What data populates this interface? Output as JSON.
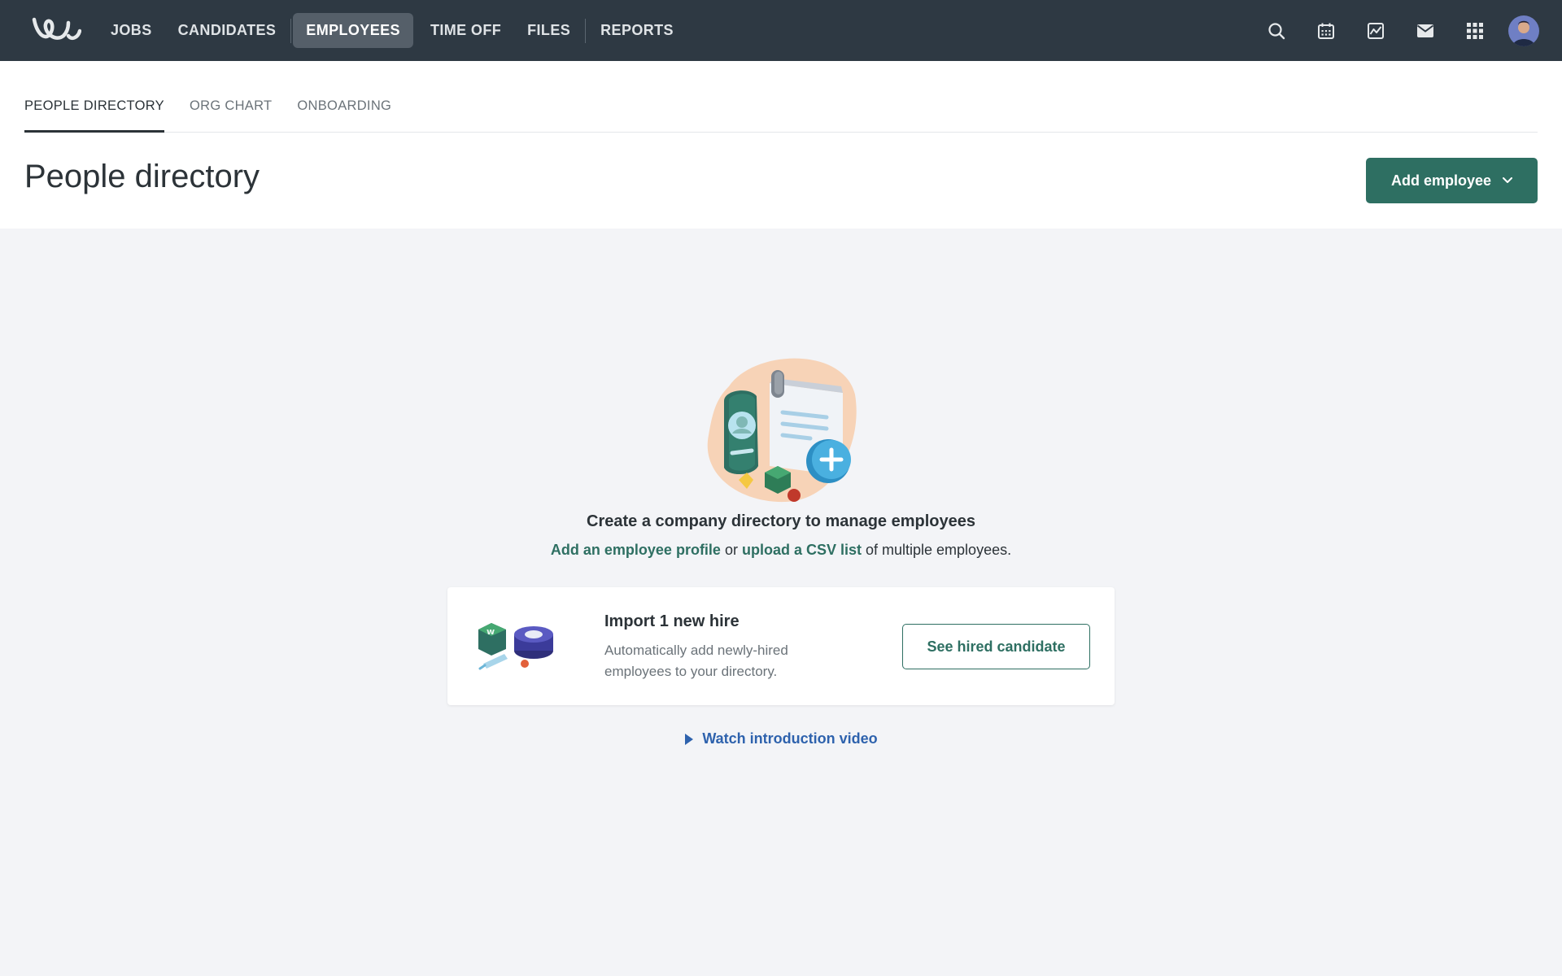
{
  "nav": {
    "items": [
      {
        "label": "JOBS"
      },
      {
        "label": "CANDIDATES"
      },
      {
        "label": "EMPLOYEES",
        "active": true
      },
      {
        "label": "TIME OFF"
      },
      {
        "label": "FILES"
      },
      {
        "label": "REPORTS"
      }
    ],
    "icons": [
      "search-icon",
      "calendar-icon",
      "activity-icon",
      "mail-icon",
      "apps-grid-icon"
    ]
  },
  "tabs": [
    {
      "label": "PEOPLE DIRECTORY",
      "active": true
    },
    {
      "label": "ORG CHART"
    },
    {
      "label": "ONBOARDING"
    }
  ],
  "page": {
    "title": "People directory",
    "add_button": "Add employee"
  },
  "empty_state": {
    "title": "Create a company directory to manage employees",
    "link1": "Add an employee profile",
    "middle": " or ",
    "link2": "upload a CSV list",
    "end": " of multiple employees."
  },
  "import_card": {
    "title": "Import 1 new hire",
    "description": "Automatically add newly-hired employees to your directory.",
    "button": "See hired candidate"
  },
  "video_link": "Watch introduction video",
  "colors": {
    "nav_bg": "#2e3943",
    "accent": "#2e6f62",
    "link_blue": "#2e62ad",
    "page_bg": "#f3f4f7"
  }
}
